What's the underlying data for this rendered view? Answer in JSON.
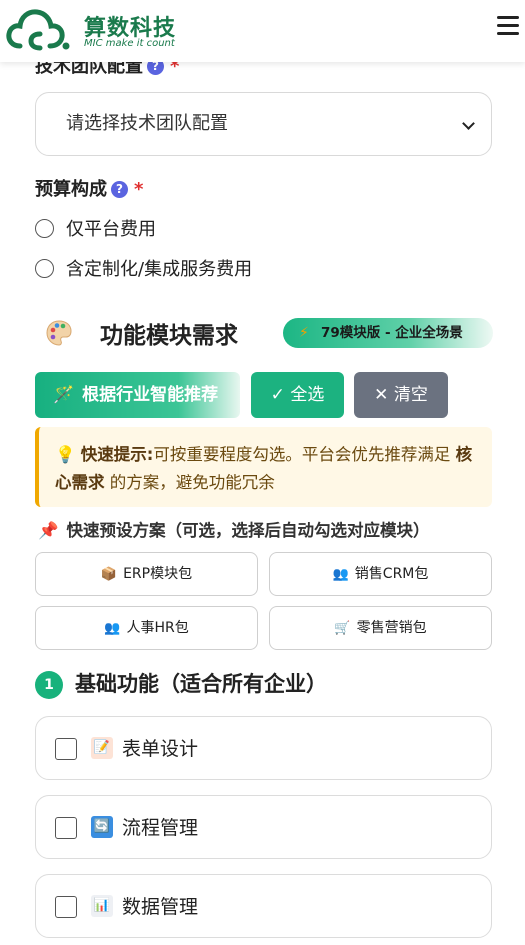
{
  "brand": {
    "name": "算数科技",
    "tagline": "MIC make it count"
  },
  "tech_team": {
    "label": "技术团队配置",
    "select_value": "请选择技术团队配置"
  },
  "budget": {
    "label": "预算构成",
    "options": [
      "仅平台费用",
      "含定制化/集成服务费用"
    ]
  },
  "modules_section": {
    "title": "功能模块需求",
    "badge": "79模块版 - 企业全场景",
    "recommend_btn": "根据行业智能推荐",
    "select_all_btn": "✓ 全选",
    "clear_btn": "✕ 清空",
    "tip_label": "快速提示:",
    "tip_text_1": "可按重要程度勾选。平台会优先推荐满足",
    "tip_core": "核心需求",
    "tip_text_2": "的方案，避免功能冗余",
    "preset_title": "快速预设方案（可选，选择后自动勾选对应模块）",
    "presets": [
      "ERP模块包",
      "销售CRM包",
      "人事HR包",
      "零售营销包"
    ],
    "group_number": "1",
    "group_title": "基础功能（适合所有企业）",
    "modules": [
      "表单设计",
      "流程管理",
      "数据管理"
    ]
  },
  "colors": {
    "brand": "#1a7a4c",
    "accent": "#18b27c",
    "help": "#5a64e0",
    "required": "#e03030",
    "tip_border": "#f0a800"
  }
}
